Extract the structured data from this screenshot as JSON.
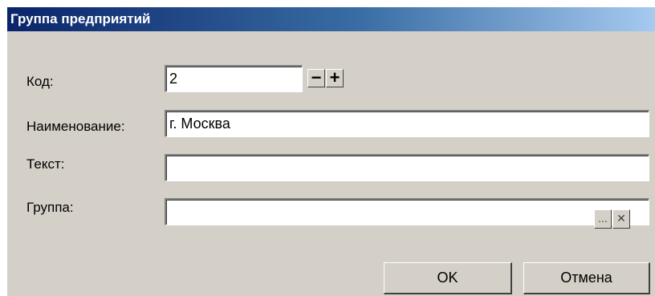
{
  "dialog": {
    "title": "Группа предприятий"
  },
  "fields": {
    "code": {
      "label": "Код:",
      "value": "2"
    },
    "name": {
      "label": "Наименование:",
      "value": "г. Москва"
    },
    "text": {
      "label": "Текст:",
      "value": ""
    },
    "group": {
      "label": "Группа:",
      "value": ""
    }
  },
  "spin": {
    "minus": "−",
    "plus": "+"
  },
  "group_buttons": {
    "browse": "...",
    "clear": "✕"
  },
  "buttons": {
    "ok": "OK",
    "cancel": "Отмена"
  },
  "colors": {
    "title_gradient_start": "#0a246a",
    "title_gradient_end": "#a6caf0",
    "dialog_face": "#d4d0c8"
  }
}
